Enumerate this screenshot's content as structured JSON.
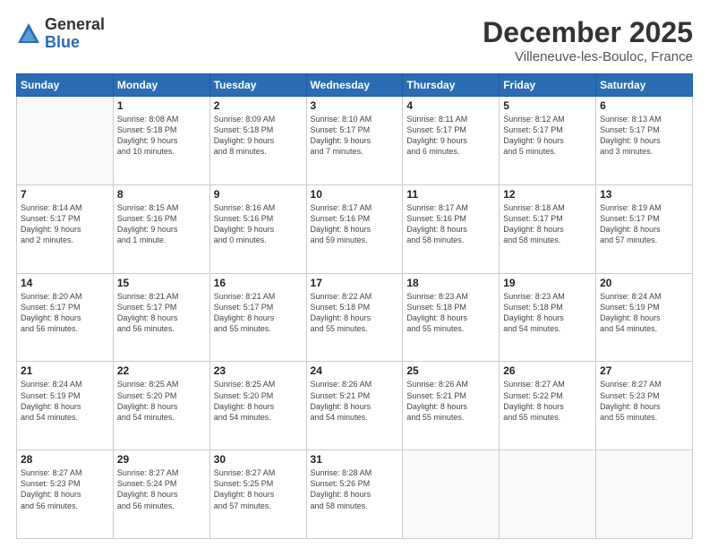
{
  "header": {
    "logo_general": "General",
    "logo_blue": "Blue",
    "month_title": "December 2025",
    "subtitle": "Villeneuve-les-Bouloc, France"
  },
  "days_of_week": [
    "Sunday",
    "Monday",
    "Tuesday",
    "Wednesday",
    "Thursday",
    "Friday",
    "Saturday"
  ],
  "weeks": [
    [
      {
        "day": "",
        "info": ""
      },
      {
        "day": "1",
        "info": "Sunrise: 8:08 AM\nSunset: 5:18 PM\nDaylight: 9 hours\nand 10 minutes."
      },
      {
        "day": "2",
        "info": "Sunrise: 8:09 AM\nSunset: 5:18 PM\nDaylight: 9 hours\nand 8 minutes."
      },
      {
        "day": "3",
        "info": "Sunrise: 8:10 AM\nSunset: 5:17 PM\nDaylight: 9 hours\nand 7 minutes."
      },
      {
        "day": "4",
        "info": "Sunrise: 8:11 AM\nSunset: 5:17 PM\nDaylight: 9 hours\nand 6 minutes."
      },
      {
        "day": "5",
        "info": "Sunrise: 8:12 AM\nSunset: 5:17 PM\nDaylight: 9 hours\nand 5 minutes."
      },
      {
        "day": "6",
        "info": "Sunrise: 8:13 AM\nSunset: 5:17 PM\nDaylight: 9 hours\nand 3 minutes."
      }
    ],
    [
      {
        "day": "7",
        "info": "Sunrise: 8:14 AM\nSunset: 5:17 PM\nDaylight: 9 hours\nand 2 minutes."
      },
      {
        "day": "8",
        "info": "Sunrise: 8:15 AM\nSunset: 5:16 PM\nDaylight: 9 hours\nand 1 minute."
      },
      {
        "day": "9",
        "info": "Sunrise: 8:16 AM\nSunset: 5:16 PM\nDaylight: 9 hours\nand 0 minutes."
      },
      {
        "day": "10",
        "info": "Sunrise: 8:17 AM\nSunset: 5:16 PM\nDaylight: 8 hours\nand 59 minutes."
      },
      {
        "day": "11",
        "info": "Sunrise: 8:17 AM\nSunset: 5:16 PM\nDaylight: 8 hours\nand 58 minutes."
      },
      {
        "day": "12",
        "info": "Sunrise: 8:18 AM\nSunset: 5:17 PM\nDaylight: 8 hours\nand 58 minutes."
      },
      {
        "day": "13",
        "info": "Sunrise: 8:19 AM\nSunset: 5:17 PM\nDaylight: 8 hours\nand 57 minutes."
      }
    ],
    [
      {
        "day": "14",
        "info": "Sunrise: 8:20 AM\nSunset: 5:17 PM\nDaylight: 8 hours\nand 56 minutes."
      },
      {
        "day": "15",
        "info": "Sunrise: 8:21 AM\nSunset: 5:17 PM\nDaylight: 8 hours\nand 56 minutes."
      },
      {
        "day": "16",
        "info": "Sunrise: 8:21 AM\nSunset: 5:17 PM\nDaylight: 8 hours\nand 55 minutes."
      },
      {
        "day": "17",
        "info": "Sunrise: 8:22 AM\nSunset: 5:18 PM\nDaylight: 8 hours\nand 55 minutes."
      },
      {
        "day": "18",
        "info": "Sunrise: 8:23 AM\nSunset: 5:18 PM\nDaylight: 8 hours\nand 55 minutes."
      },
      {
        "day": "19",
        "info": "Sunrise: 8:23 AM\nSunset: 5:18 PM\nDaylight: 8 hours\nand 54 minutes."
      },
      {
        "day": "20",
        "info": "Sunrise: 8:24 AM\nSunset: 5:19 PM\nDaylight: 8 hours\nand 54 minutes."
      }
    ],
    [
      {
        "day": "21",
        "info": "Sunrise: 8:24 AM\nSunset: 5:19 PM\nDaylight: 8 hours\nand 54 minutes."
      },
      {
        "day": "22",
        "info": "Sunrise: 8:25 AM\nSunset: 5:20 PM\nDaylight: 8 hours\nand 54 minutes."
      },
      {
        "day": "23",
        "info": "Sunrise: 8:25 AM\nSunset: 5:20 PM\nDaylight: 8 hours\nand 54 minutes."
      },
      {
        "day": "24",
        "info": "Sunrise: 8:26 AM\nSunset: 5:21 PM\nDaylight: 8 hours\nand 54 minutes."
      },
      {
        "day": "25",
        "info": "Sunrise: 8:26 AM\nSunset: 5:21 PM\nDaylight: 8 hours\nand 55 minutes."
      },
      {
        "day": "26",
        "info": "Sunrise: 8:27 AM\nSunset: 5:22 PM\nDaylight: 8 hours\nand 55 minutes."
      },
      {
        "day": "27",
        "info": "Sunrise: 8:27 AM\nSunset: 5:23 PM\nDaylight: 8 hours\nand 55 minutes."
      }
    ],
    [
      {
        "day": "28",
        "info": "Sunrise: 8:27 AM\nSunset: 5:23 PM\nDaylight: 8 hours\nand 56 minutes."
      },
      {
        "day": "29",
        "info": "Sunrise: 8:27 AM\nSunset: 5:24 PM\nDaylight: 8 hours\nand 56 minutes."
      },
      {
        "day": "30",
        "info": "Sunrise: 8:27 AM\nSunset: 5:25 PM\nDaylight: 8 hours\nand 57 minutes."
      },
      {
        "day": "31",
        "info": "Sunrise: 8:28 AM\nSunset: 5:26 PM\nDaylight: 8 hours\nand 58 minutes."
      },
      {
        "day": "",
        "info": ""
      },
      {
        "day": "",
        "info": ""
      },
      {
        "day": "",
        "info": ""
      }
    ]
  ]
}
